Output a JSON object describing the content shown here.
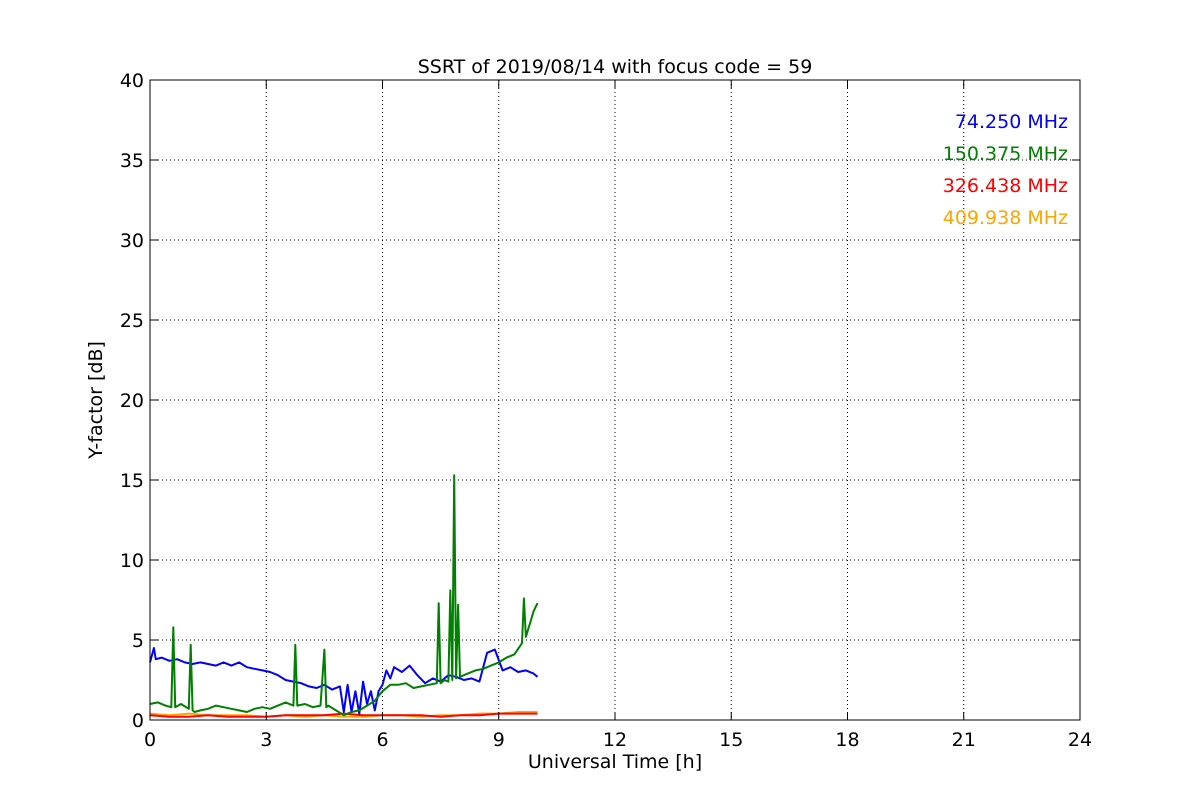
{
  "chart_data": {
    "type": "line",
    "title": "SSRT of 2019/08/14 with focus code = 59",
    "xlabel": "Universal Time [h]",
    "ylabel": "Y-factor [dB]",
    "xlim": [
      0,
      24
    ],
    "ylim": [
      0,
      40
    ],
    "xticks": [
      0,
      3,
      6,
      9,
      12,
      15,
      18,
      21,
      24
    ],
    "yticks": [
      0,
      5,
      10,
      15,
      20,
      25,
      30,
      35,
      40
    ],
    "grid": true,
    "legend_position": "top-right",
    "series": [
      {
        "name": "74.250 MHz",
        "color": "#0000ff",
        "x": [
          0.0,
          0.1,
          0.15,
          0.3,
          0.5,
          0.7,
          0.9,
          1.1,
          1.3,
          1.5,
          1.7,
          1.9,
          2.1,
          2.3,
          2.5,
          2.7,
          2.9,
          3.1,
          3.3,
          3.5,
          3.7,
          3.9,
          4.1,
          4.3,
          4.5,
          4.7,
          4.9,
          5.0,
          5.1,
          5.2,
          5.3,
          5.4,
          5.5,
          5.6,
          5.7,
          5.8,
          5.9,
          6.0,
          6.1,
          6.2,
          6.3,
          6.5,
          6.7,
          6.9,
          7.1,
          7.3,
          7.5,
          7.7,
          7.9,
          8.1,
          8.3,
          8.5,
          8.7,
          8.9,
          9.1,
          9.3,
          9.5,
          9.7,
          9.9,
          10.0
        ],
        "y": [
          3.6,
          4.5,
          3.8,
          3.9,
          3.7,
          3.8,
          3.6,
          3.5,
          3.6,
          3.5,
          3.4,
          3.6,
          3.4,
          3.6,
          3.3,
          3.2,
          3.1,
          3.0,
          2.8,
          2.5,
          2.4,
          2.3,
          2.1,
          2.0,
          2.2,
          1.9,
          2.1,
          0.5,
          2.2,
          0.5,
          1.8,
          0.4,
          2.4,
          1.0,
          1.8,
          0.6,
          1.8,
          2.2,
          3.1,
          2.6,
          3.3,
          3.0,
          3.4,
          2.8,
          2.3,
          2.6,
          2.4,
          2.8,
          2.7,
          2.5,
          2.6,
          2.4,
          4.2,
          4.4,
          3.1,
          3.3,
          3.0,
          3.1,
          2.9,
          2.7
        ]
      },
      {
        "name": "150.375 MHz",
        "color": "#008000",
        "x": [
          0.0,
          0.2,
          0.4,
          0.55,
          0.6,
          0.65,
          0.8,
          1.0,
          1.05,
          1.1,
          1.15,
          1.3,
          1.5,
          1.7,
          1.9,
          2.1,
          2.3,
          2.5,
          2.7,
          2.9,
          3.1,
          3.3,
          3.5,
          3.7,
          3.75,
          3.8,
          4.0,
          4.2,
          4.4,
          4.5,
          4.55,
          4.6,
          4.8,
          5.0,
          5.2,
          5.4,
          5.6,
          5.8,
          6.0,
          6.2,
          6.4,
          6.6,
          6.8,
          7.0,
          7.2,
          7.4,
          7.45,
          7.5,
          7.6,
          7.7,
          7.75,
          7.8,
          7.85,
          7.9,
          7.95,
          8.0,
          8.2,
          8.4,
          8.6,
          8.8,
          9.0,
          9.2,
          9.4,
          9.6,
          9.65,
          9.7,
          9.8,
          9.9,
          10.0
        ],
        "y": [
          1.0,
          1.1,
          0.9,
          0.8,
          5.8,
          0.8,
          1.0,
          0.7,
          4.7,
          0.6,
          0.5,
          0.6,
          0.7,
          0.9,
          0.8,
          0.7,
          0.6,
          0.5,
          0.7,
          0.8,
          0.7,
          0.9,
          1.1,
          0.9,
          4.7,
          0.9,
          1.0,
          0.8,
          0.9,
          4.4,
          0.8,
          0.9,
          0.6,
          0.3,
          0.5,
          0.6,
          0.9,
          1.2,
          1.8,
          2.2,
          2.2,
          2.3,
          2.0,
          2.1,
          2.2,
          2.3,
          7.3,
          2.3,
          2.5,
          2.4,
          8.1,
          2.5,
          15.3,
          2.6,
          7.2,
          2.7,
          2.9,
          3.1,
          3.2,
          3.4,
          3.6,
          3.9,
          4.1,
          4.8,
          7.6,
          5.2,
          6.0,
          6.8,
          7.3
        ]
      },
      {
        "name": "326.438 MHz",
        "color": "#ff0000",
        "x": [
          0.0,
          0.5,
          1.0,
          1.5,
          2.0,
          2.5,
          3.0,
          3.5,
          4.0,
          4.5,
          5.0,
          5.5,
          6.0,
          6.5,
          7.0,
          7.5,
          8.0,
          8.5,
          9.0,
          9.5,
          10.0
        ],
        "y": [
          0.3,
          0.2,
          0.2,
          0.3,
          0.2,
          0.2,
          0.2,
          0.3,
          0.3,
          0.3,
          0.4,
          0.3,
          0.3,
          0.3,
          0.3,
          0.2,
          0.3,
          0.3,
          0.4,
          0.4,
          0.4
        ]
      },
      {
        "name": "409.938 MHz",
        "color": "#ffa500",
        "x": [
          0.0,
          0.5,
          1.0,
          1.5,
          2.0,
          2.5,
          3.0,
          3.5,
          4.0,
          4.5,
          5.0,
          5.5,
          6.0,
          6.5,
          7.0,
          7.5,
          8.0,
          8.5,
          9.0,
          9.5,
          10.0
        ],
        "y": [
          0.4,
          0.3,
          0.4,
          0.3,
          0.3,
          0.3,
          0.2,
          0.3,
          0.2,
          0.3,
          0.2,
          0.2,
          0.3,
          0.3,
          0.2,
          0.3,
          0.3,
          0.4,
          0.4,
          0.5,
          0.5
        ]
      }
    ]
  }
}
